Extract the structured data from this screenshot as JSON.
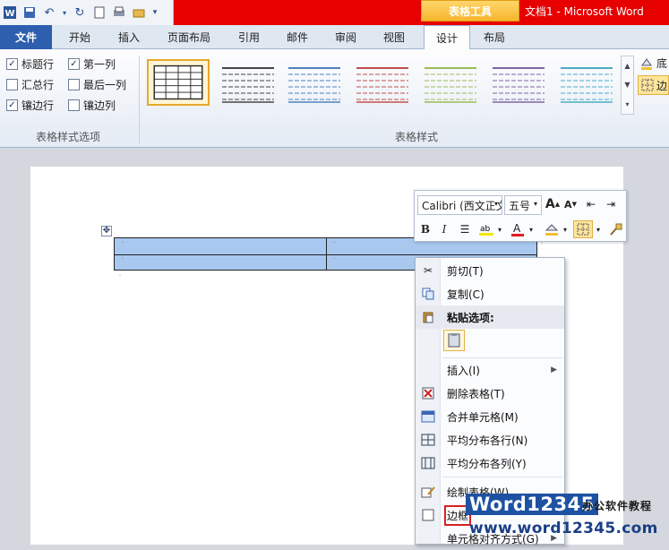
{
  "title_bar": {
    "context_tab_group": "表格工具",
    "doc_title": "文档1 - Microsoft Word"
  },
  "tabs": {
    "file": "文件",
    "items": [
      "开始",
      "插入",
      "页面布局",
      "引用",
      "邮件",
      "审阅",
      "视图",
      "设计",
      "布局"
    ],
    "active": "设计"
  },
  "ribbon": {
    "options": {
      "header_row": "标题行",
      "first_column": "第一列",
      "total_row": "汇总行",
      "last_column": "最后一列",
      "banded_rows": "镶边行",
      "banded_columns": "镶边列"
    },
    "options_checked": {
      "header_row": true,
      "first_column": true,
      "total_row": false,
      "last_column": false,
      "banded_rows": true,
      "banded_columns": false
    },
    "group_options_label": "表格样式选项",
    "group_styles_label": "表格样式",
    "style_colors": [
      "#222222",
      "#444444",
      "#4f81bd",
      "#c0504d",
      "#9bbb59",
      "#8064a2",
      "#4bacc6"
    ],
    "right_partial": {
      "shading": "底",
      "borders": "边"
    }
  },
  "mini_toolbar": {
    "font": "Calibri (西文正文)",
    "size": "五号",
    "bold": "B",
    "italic": "I",
    "grow_font": "A",
    "shrink_font": "A"
  },
  "context_menu": {
    "cut": "剪切(T)",
    "copy": "复制(C)",
    "paste_options": "粘贴选项:",
    "insert": "插入(I)",
    "delete_table": "删除表格(T)",
    "merge_cells": "合并单元格(M)",
    "distribute_rows": "平均分布各行(N)",
    "distribute_columns": "平均分布各列(Y)",
    "draw_table": "绘制表格(W)",
    "borders": "边框",
    "cell_alignment": "单元格对齐方式(G)"
  },
  "watermark": {
    "brand": "Word12345",
    "brand_cn": "办公软件教程",
    "url": "www.word12345.com"
  }
}
